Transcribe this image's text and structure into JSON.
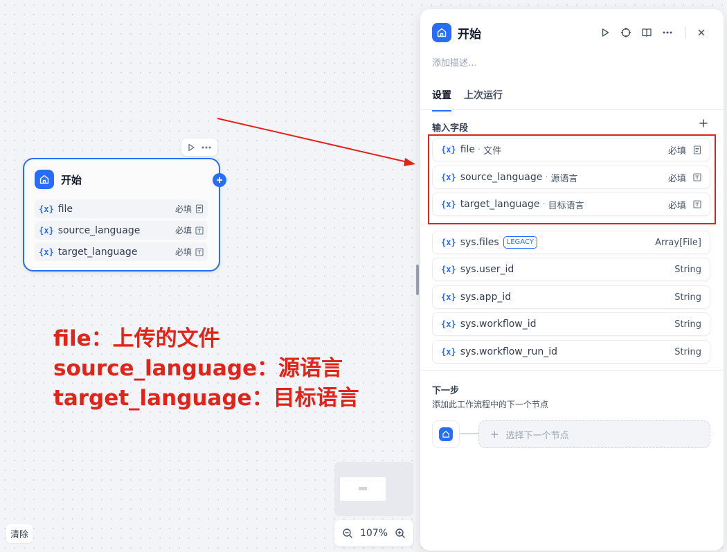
{
  "canvas": {
    "node": {
      "title": "开始",
      "fields": [
        {
          "name": "file",
          "required": "必填",
          "icon": "document-icon"
        },
        {
          "name": "source_language",
          "required": "必填",
          "icon": "text-input-icon"
        },
        {
          "name": "target_language",
          "required": "必填",
          "icon": "text-input-icon"
        }
      ]
    },
    "annotation": {
      "line1": "file：上传的文件",
      "line2": "source_language：源语言",
      "line3": "target_language：目标语言",
      "color": "#e0241a"
    },
    "clear_label": "清除",
    "zoom_level": "107%"
  },
  "panel": {
    "title": "开始",
    "description_placeholder": "添加描述...",
    "tabs": [
      {
        "label": "设置",
        "active": true
      },
      {
        "label": "上次运行",
        "active": false
      }
    ],
    "input_section_label": "输入字段",
    "var_symbol": "{x}",
    "dot": "·",
    "user_fields": [
      {
        "name": "file",
        "label": "文件",
        "required": "必填"
      },
      {
        "name": "source_language",
        "label": "源语言",
        "required": "必填"
      },
      {
        "name": "target_language",
        "label": "目标语言",
        "required": "必填"
      }
    ],
    "system_fields": [
      {
        "name": "sys.files",
        "badge": "LEGACY",
        "type": "Array[File]"
      },
      {
        "name": "sys.user_id",
        "type": "String"
      },
      {
        "name": "sys.app_id",
        "type": "String"
      },
      {
        "name": "sys.workflow_id",
        "type": "String"
      },
      {
        "name": "sys.workflow_run_id",
        "type": "String"
      }
    ],
    "next_step": {
      "title": "下一步",
      "description": "添加此工作流程中的下一个节点",
      "select_label": "选择下一个节点",
      "plus": "+"
    }
  },
  "colors": {
    "accent": "#296dff",
    "annotation_red": "#e0241a"
  }
}
